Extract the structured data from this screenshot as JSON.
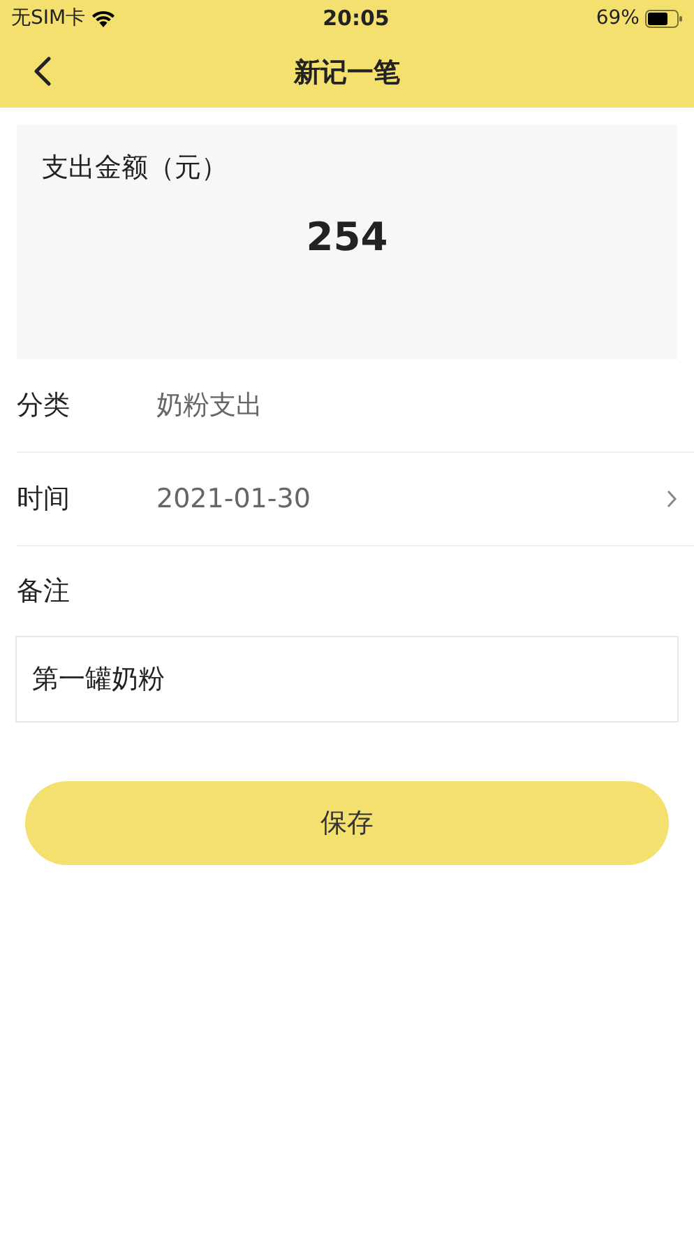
{
  "status_bar": {
    "carrier": "无SIM卡",
    "time": "20:05",
    "battery": "69%"
  },
  "nav": {
    "title": "新记一笔"
  },
  "amount": {
    "label": "支出金额（元）",
    "value": "254"
  },
  "rows": [
    {
      "label": "分类",
      "value": "奶粉支出",
      "chevron": false
    },
    {
      "label": "时间",
      "value": "2021-01-30",
      "chevron": true
    }
  ],
  "note": {
    "label": "备注",
    "value": "第一罐奶粉"
  },
  "save_button": "保存"
}
